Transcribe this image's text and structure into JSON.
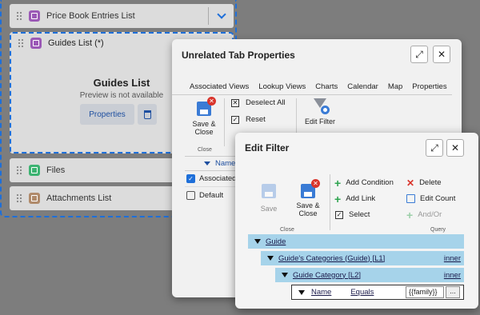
{
  "background": {
    "rows": [
      {
        "label": "Price Book Entries List",
        "color": "#9b59b6"
      },
      {
        "label": "Guides List (*)",
        "color": "#9b59b6"
      },
      {
        "label": "Files",
        "color": "#3cb371"
      },
      {
        "label": "Attachments List",
        "color": "#b08a6a"
      }
    ],
    "preview_title": "Guides List",
    "preview_subtitle": "Preview is not available",
    "properties_button": "Properties"
  },
  "unrelated_dialog": {
    "title": "Unrelated Tab Properties",
    "tabs": [
      "Associated Views",
      "Lookup Views",
      "Charts",
      "Calendar",
      "Map",
      "Properties"
    ],
    "save_close": "Save & Close",
    "deselect_all": "Deselect All",
    "reset": "Reset",
    "edit_filter": "Edit Filter",
    "close_group": "Close",
    "column_name": "Name",
    "rows": [
      {
        "label": "Associated",
        "checked": true
      },
      {
        "label": "Default",
        "checked": false
      }
    ]
  },
  "edit_filter": {
    "title": "Edit Filter",
    "save": "Save",
    "save_close": "Save & Close",
    "add_condition": "Add Condition",
    "add_link": "Add Link",
    "select": "Select",
    "delete": "Delete",
    "edit_count": "Edit Count",
    "and_or": "And/Or",
    "close_group": "Close",
    "query_group": "Query",
    "tree": {
      "root": "Guide",
      "level1": "Guide's Categories (Guide) [L1]",
      "level1_join": "inner",
      "level2": "Guide Category [L2]",
      "level2_join": "inner",
      "condition_field": "Name",
      "condition_op": "Equals",
      "condition_value": "{{family}}",
      "condition_more": "..."
    }
  },
  "colors": {
    "accent": "#1e6fd9",
    "tree_highlight": "#a6d3ea",
    "delete_red": "#d9342b",
    "add_green": "#2ea44f"
  }
}
